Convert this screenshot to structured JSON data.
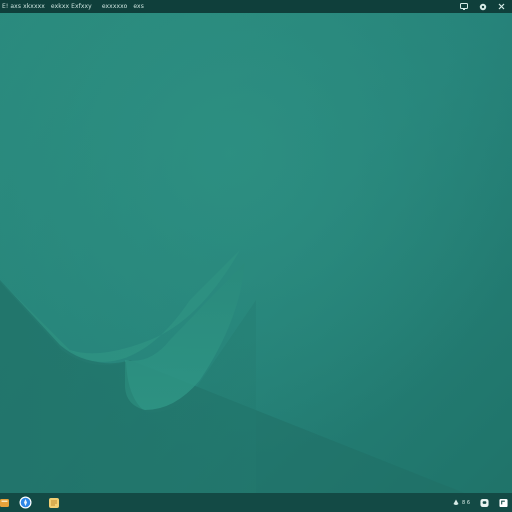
{
  "top_menu": {
    "items": [
      "E! axs xkxxxx",
      "exkxx Exfxxy",
      "exxxxxo",
      "exs"
    ]
  },
  "top_tray": {
    "icons": [
      "monitor-icon",
      "settings-icon",
      "close-icon"
    ]
  },
  "taskbar": {
    "launchers": [
      "files-icon",
      "browser-icon",
      "notes-icon"
    ],
    "status_text": "8 6",
    "tray_icons": [
      "network-icon",
      "chat-icon",
      "notification-icon"
    ]
  },
  "colors": {
    "wallpaper": "#23796f",
    "top_bar": "#0f3f3b",
    "taskbar": "#134a45",
    "browser_icon": "#2f86e6",
    "files_icon": "#e8a23a",
    "notes_icon": "#f2cf73"
  }
}
